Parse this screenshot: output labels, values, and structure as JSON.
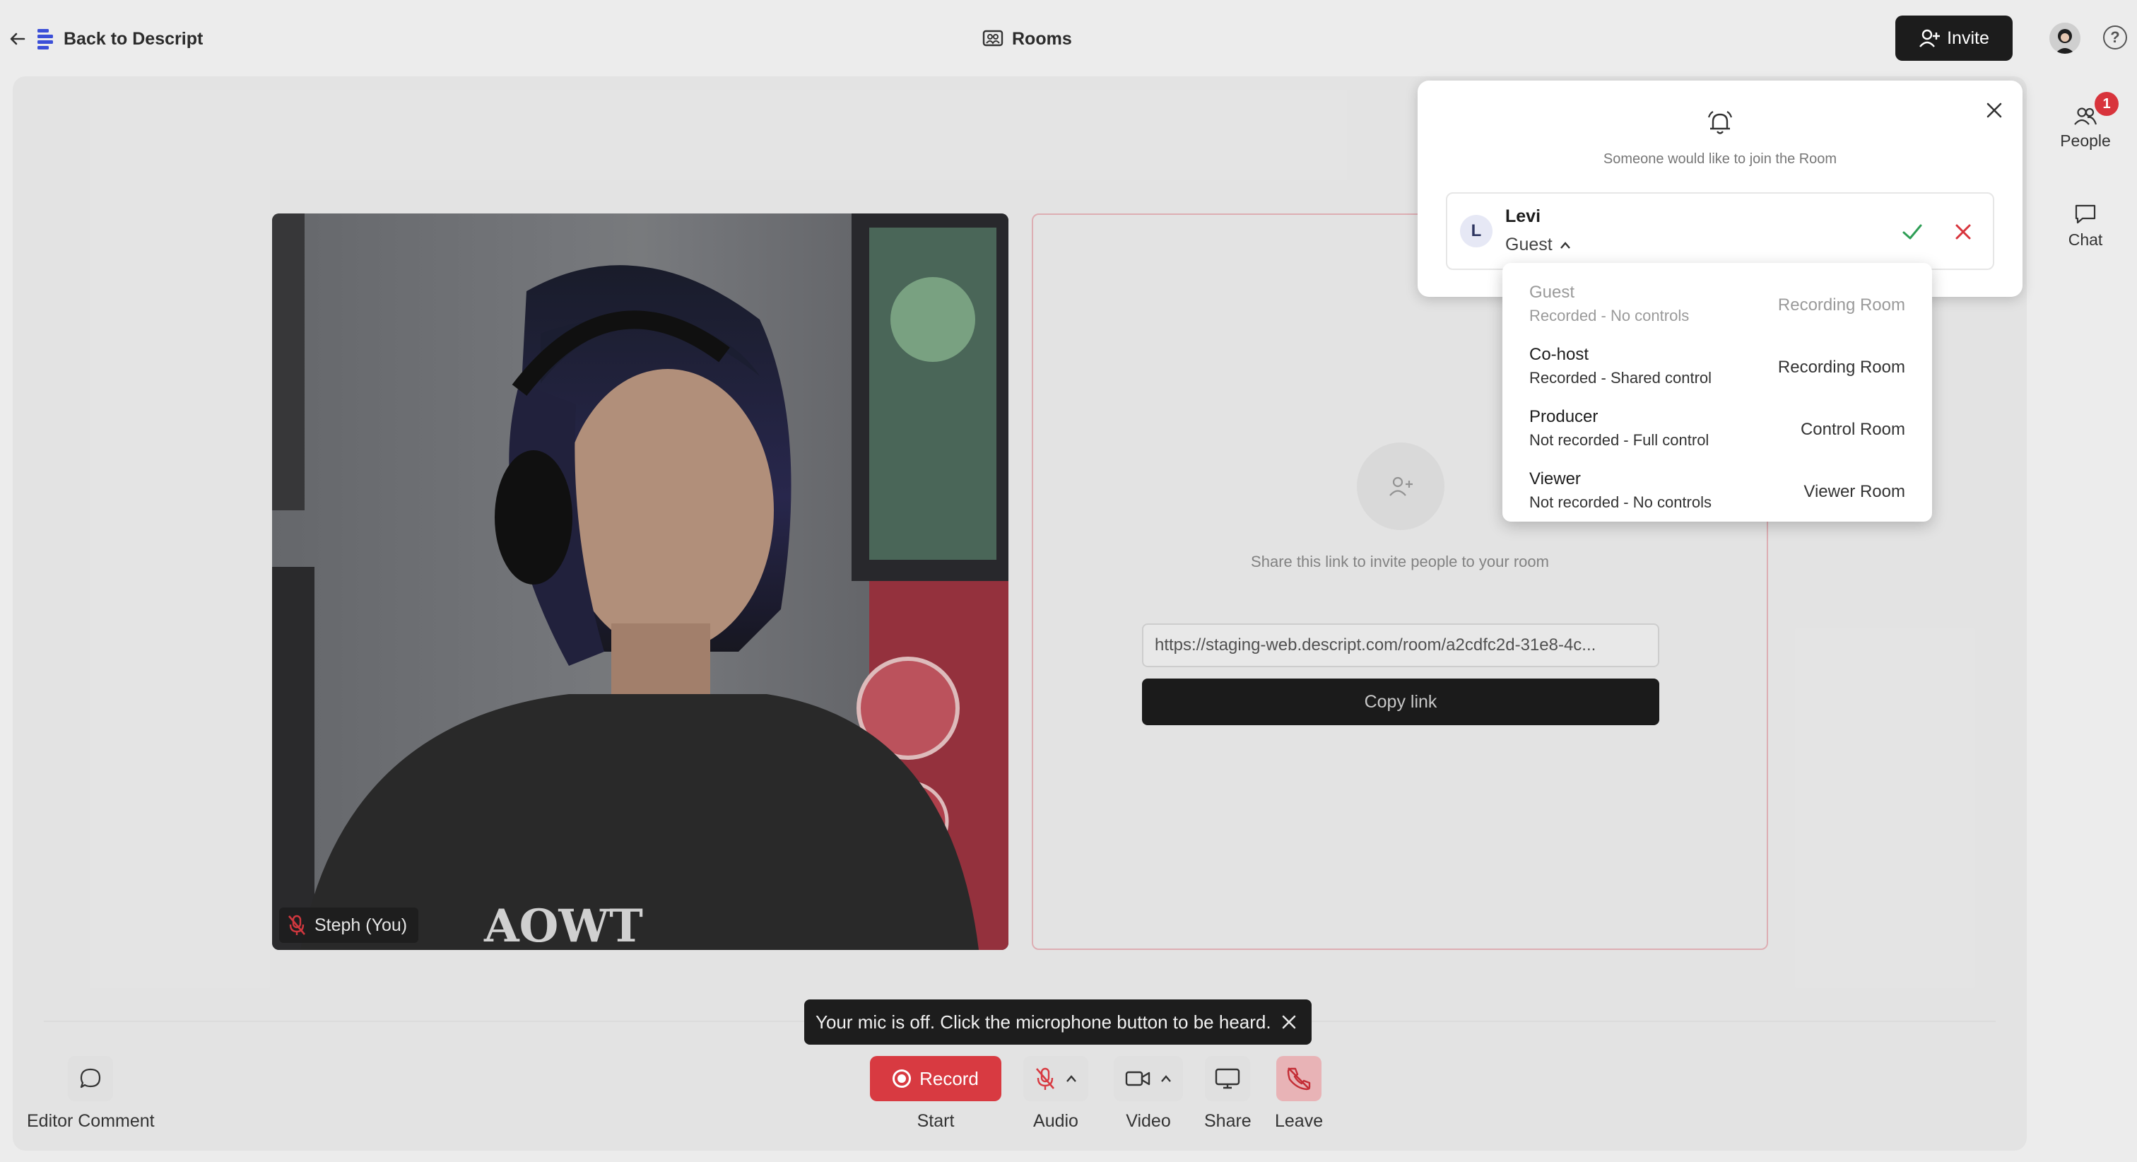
{
  "topbar": {
    "back_label": "Back to Descript",
    "title": "Rooms",
    "invite_label": "Invite"
  },
  "video": {
    "participant_label": "Steph (You)",
    "shirt_text": "AOWT"
  },
  "invite_tile": {
    "message": "Share this link to invite people to your room",
    "link": "https://staging-web.descript.com/room/a2cdfc2d-31e8-4c...",
    "copy_label": "Copy link"
  },
  "right_rail": {
    "people_label": "People",
    "people_badge": "1",
    "chat_label": "Chat"
  },
  "join_request": {
    "message": "Someone would like to join the Room",
    "requester_initial": "L",
    "requester_name": "Levi",
    "selected_role": "Guest"
  },
  "role_options": [
    {
      "name": "Guest",
      "description": "Recorded - No controls",
      "room": "Recording Room",
      "disabled": true
    },
    {
      "name": "Co-host",
      "description": "Recorded - Shared control",
      "room": "Recording Room",
      "disabled": false
    },
    {
      "name": "Producer",
      "description": "Not recorded - Full control",
      "room": "Control Room",
      "disabled": false
    },
    {
      "name": "Viewer",
      "description": "Not recorded - No controls",
      "room": "Viewer Room",
      "disabled": false
    }
  ],
  "toast": {
    "message": "Your mic is off. Click the microphone button to be heard."
  },
  "toolbar": {
    "editor_comment_label": "Editor Comment",
    "record_label": "Record",
    "start_label": "Start",
    "audio_label": "Audio",
    "video_label": "Video",
    "share_label": "Share",
    "leave_label": "Leave"
  },
  "colors": {
    "record": "#d83a41",
    "approve": "#2f9e56",
    "reject": "#d8343c",
    "badge": "#d8343c",
    "dark_button": "#1c1c1c",
    "brand_logo": "#3b4fd8"
  }
}
